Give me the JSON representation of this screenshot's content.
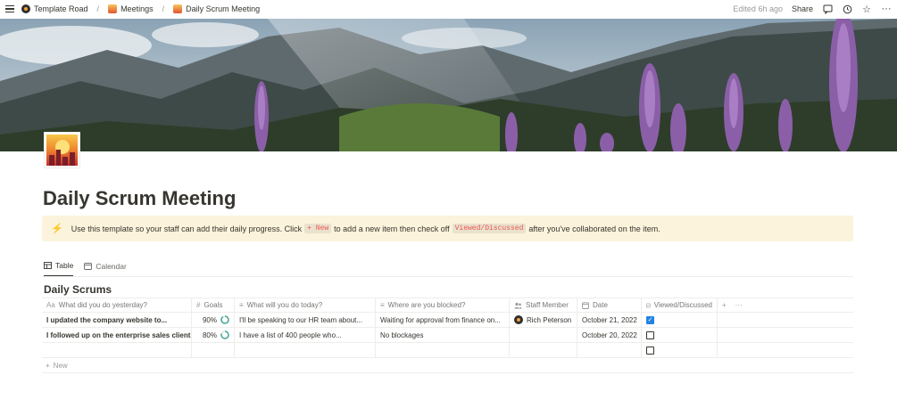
{
  "breadcrumb": {
    "items": [
      "Template Road",
      "Meetings",
      "Daily Scrum Meeting"
    ],
    "separator": "/"
  },
  "topbar": {
    "edited": "Edited 6h ago",
    "share": "Share"
  },
  "page": {
    "title": "Daily Scrum Meeting"
  },
  "callout": {
    "icon": "⚡",
    "text_1": "Use this template so your staff can add their daily progress. Click",
    "code_1": "+ New",
    "text_2": "to add a new item then check off",
    "code_2": "Viewed/Discussed",
    "text_3": "after you've collaborated on the item."
  },
  "views": {
    "tabs": [
      "Table",
      "Calendar"
    ]
  },
  "database": {
    "title": "Daily Scrums",
    "columns": [
      "What did you do yesterday?",
      "Goals",
      "What will you do today?",
      "Where are you blocked?",
      "Staff Member",
      "Date",
      "Viewed/Discussed"
    ],
    "column_icons": [
      "Aa",
      "#",
      "≡",
      "≡",
      "person-icon",
      "calendar-icon",
      "checkbox-icon"
    ],
    "rows": [
      {
        "yesterday": "I updated the company website to...",
        "goals": "90%",
        "goals_value": 0.9,
        "today": "I'll be speaking to our HR team about...",
        "blocked": "Waiting for approval from finance on...",
        "staff": "Rich Peterson",
        "date": "October 21, 2022",
        "viewed": true
      },
      {
        "yesterday": "I followed up on the enterprise sales client...",
        "goals": "80%",
        "goals_value": 0.8,
        "today": "I have a list of 400 people who...",
        "blocked": "No blockages",
        "staff": "",
        "date": "October 20, 2022",
        "viewed": false
      }
    ],
    "new_label": "New",
    "add_column": "+",
    "more": "···"
  },
  "colors": {
    "accent": "#2383e2",
    "callout_bg": "#fbf3db",
    "code_text": "#eb5757",
    "goal_ring": "#4dab9a"
  }
}
